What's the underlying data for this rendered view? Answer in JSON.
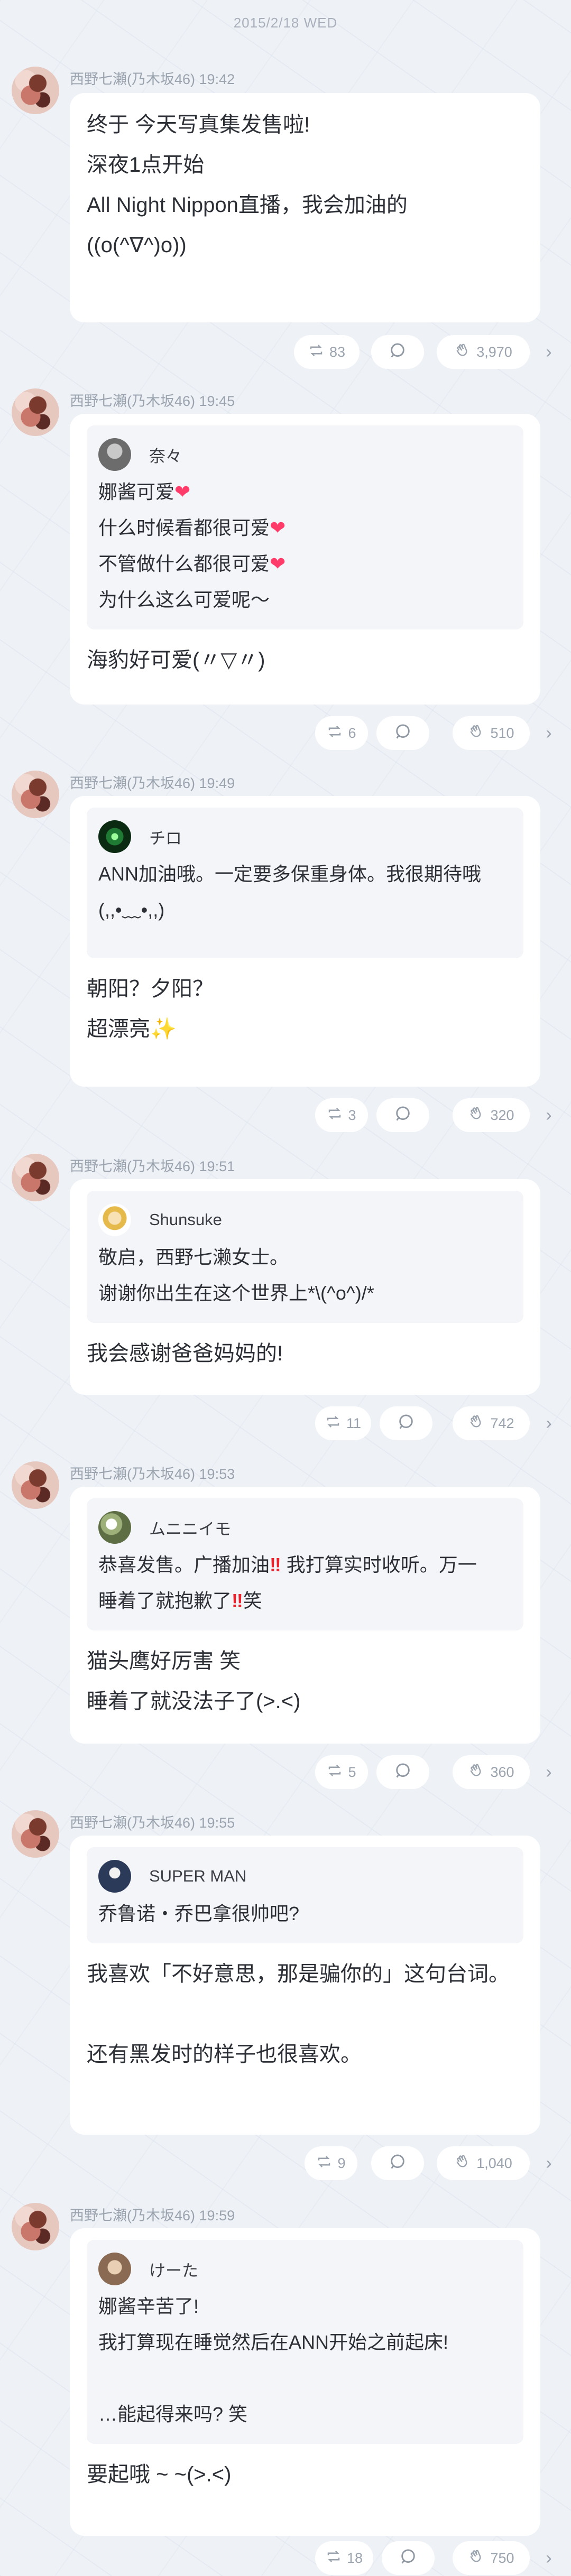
{
  "date": "2015/2/18 WED",
  "colors": {
    "background": "#eef1f6",
    "card": "#ffffff",
    "quote": "#f3f5f8",
    "meta": "#9aa3ae",
    "heart": "#ff3b6a"
  },
  "posts": [
    {
      "author": "西野七瀬(乃木坂46)",
      "time": "19:42",
      "lines": [
        "终于 今天写真集发售啦!",
        "深夜1点开始",
        "All Night Nippon直播，我会加油的",
        "((o(^∇^)o))"
      ],
      "counts": {
        "repost": "83",
        "like": "3,970"
      }
    },
    {
      "author": "西野七瀬(乃木坂46)",
      "time": "19:45",
      "quote": {
        "name": "奈々",
        "lines": [
          "娜酱可爱",
          "什么时候看都很可爱",
          "不管做什么都很可爱",
          "为什么这么可爱呢〜"
        ],
        "heart_emoji": "❤"
      },
      "lines": [
        "海豹好可爱(〃▽〃)"
      ],
      "counts": {
        "repost": "6",
        "like": "510"
      }
    },
    {
      "author": "西野七瀬(乃木坂46)",
      "time": "19:49",
      "quote": {
        "name": "チロ",
        "lines": [
          "ANN加油哦。一定要多保重身体。我很期待哦",
          "(,,•﹏•,,)"
        ]
      },
      "lines": [
        "朝阳？夕阳？",
        "超漂亮"
      ],
      "sparkle_emoji": "✨",
      "counts": {
        "repost": "3",
        "like": "320"
      }
    },
    {
      "author": "西野七瀬(乃木坂46)",
      "time": "19:51",
      "quote": {
        "name": "Shunsuke",
        "lines": [
          "敬启，西野七濑女士。",
          "谢谢你出生在这个世界上*\\(^o^)/*"
        ]
      },
      "lines": [
        "我会感谢爸爸妈妈的!"
      ],
      "counts": {
        "repost": "11",
        "like": "742"
      }
    },
    {
      "author": "西野七瀬(乃木坂46)",
      "time": "19:53",
      "quote": {
        "name": "ムニニイモ",
        "line1a": "恭喜发售。广播加油",
        "line1b": " 我打算实时收听。万一",
        "line2a": "睡着了就抱歉了",
        "line2b": "笑",
        "bang_emoji": "‼"
      },
      "lines": [
        "猫头鹰好厉害 笑",
        "睡着了就没法子了(>.<)"
      ],
      "counts": {
        "repost": "5",
        "like": "360"
      }
    },
    {
      "author": "西野七瀬(乃木坂46)",
      "time": "19:55",
      "quote": {
        "name": "SUPER MAN",
        "lines": [
          "乔鲁诺・乔巴拿很帅吧?"
        ]
      },
      "lines": [
        "我喜欢「不好意思，那是骗你的」这句台词。",
        "",
        "还有黑发时的样子也很喜欢。"
      ],
      "counts": {
        "repost": "9",
        "like": "1,040"
      }
    },
    {
      "author": "西野七瀬(乃木坂46)",
      "time": "19:59",
      "quote": {
        "name": "けーた",
        "lines": [
          "娜酱辛苦了!",
          "我打算现在睡觉然后在ANN开始之前起床!",
          "",
          "…能起得来吗? 笑"
        ]
      },
      "lines": [
        "要起哦 ~ ~(>.<)"
      ],
      "counts": {
        "repost": "18",
        "like": "750"
      }
    }
  ]
}
